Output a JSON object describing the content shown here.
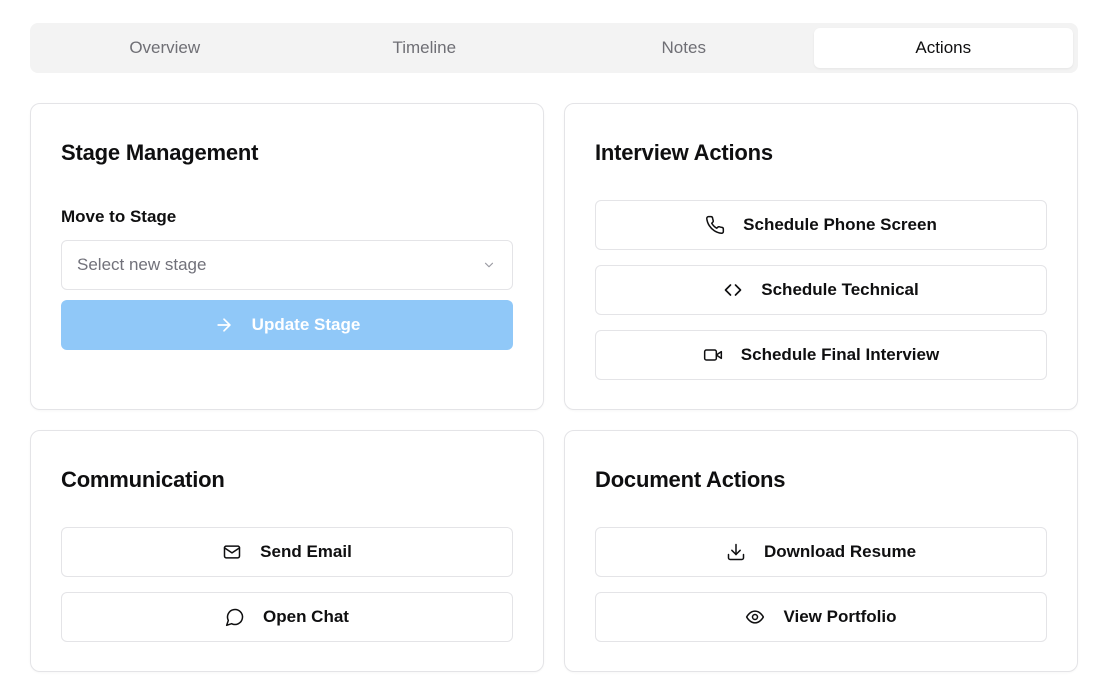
{
  "tabs": [
    {
      "label": "Overview",
      "active": false
    },
    {
      "label": "Timeline",
      "active": false
    },
    {
      "label": "Notes",
      "active": false
    },
    {
      "label": "Actions",
      "active": true
    }
  ],
  "stage_management": {
    "title": "Stage Management",
    "move_label": "Move to Stage",
    "select_placeholder": "Select new stage",
    "update_button": {
      "label": "Update Stage",
      "icon": "arrow-right-icon"
    }
  },
  "interview_actions": {
    "title": "Interview Actions",
    "buttons": [
      {
        "label": "Schedule Phone Screen",
        "icon": "phone-icon"
      },
      {
        "label": "Schedule Technical",
        "icon": "code-icon"
      },
      {
        "label": "Schedule Final Interview",
        "icon": "video-icon"
      }
    ]
  },
  "communication": {
    "title": "Communication",
    "buttons": [
      {
        "label": "Send Email",
        "icon": "mail-icon"
      },
      {
        "label": "Open Chat",
        "icon": "chat-bubble-icon"
      }
    ]
  },
  "document_actions": {
    "title": "Document Actions",
    "buttons": [
      {
        "label": "Download Resume",
        "icon": "download-icon"
      },
      {
        "label": "View Portfolio",
        "icon": "eye-icon"
      }
    ]
  },
  "colors": {
    "primary_disabled": "#90c8f8",
    "border": "#e4e4e7",
    "tab_bar_bg": "#f3f3f3",
    "muted_text": "#6f6f75"
  }
}
